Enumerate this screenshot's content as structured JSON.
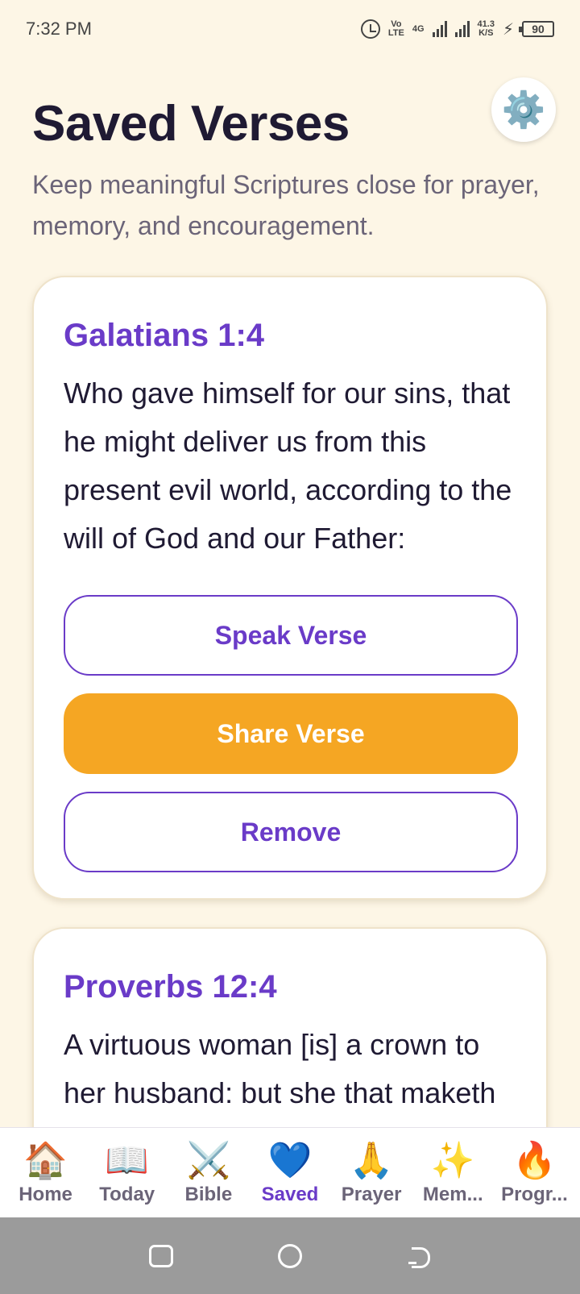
{
  "status_bar": {
    "time": "7:32 PM",
    "network_volte": "Vo LTE",
    "network_4g": "4G",
    "speed_value": "41.3",
    "speed_unit": "K/S",
    "battery": "90"
  },
  "header": {
    "title": "Saved Verses",
    "subtitle": "Keep meaningful Scriptures close for prayer, memory, and encouragement.",
    "settings_icon": "⚙️"
  },
  "cards": [
    {
      "reference": "Galatians 1:4",
      "text": "Who gave himself for our sins, that he might deliver us from this present evil world, according to the will of God and our Father:",
      "speak_label": "Speak Verse",
      "share_label": "Share Verse",
      "remove_label": "Remove"
    },
    {
      "reference": "Proverbs 12:4",
      "text": "A virtuous woman [is] a crown to her husband: but she that maketh"
    }
  ],
  "nav": {
    "items": [
      {
        "icon": "🏠",
        "label": "Home"
      },
      {
        "icon": "📖",
        "label": "Today"
      },
      {
        "icon": "⚔️",
        "label": "Bible"
      },
      {
        "icon": "💙",
        "label": "Saved"
      },
      {
        "icon": "🙏",
        "label": "Prayer"
      },
      {
        "icon": "✨",
        "label": "Mem..."
      },
      {
        "icon": "🔥",
        "label": "Progr..."
      }
    ],
    "active": "Saved"
  },
  "colors": {
    "background": "#FDF6E6",
    "accent_purple": "#6A3BC8",
    "accent_orange": "#F5A623"
  }
}
